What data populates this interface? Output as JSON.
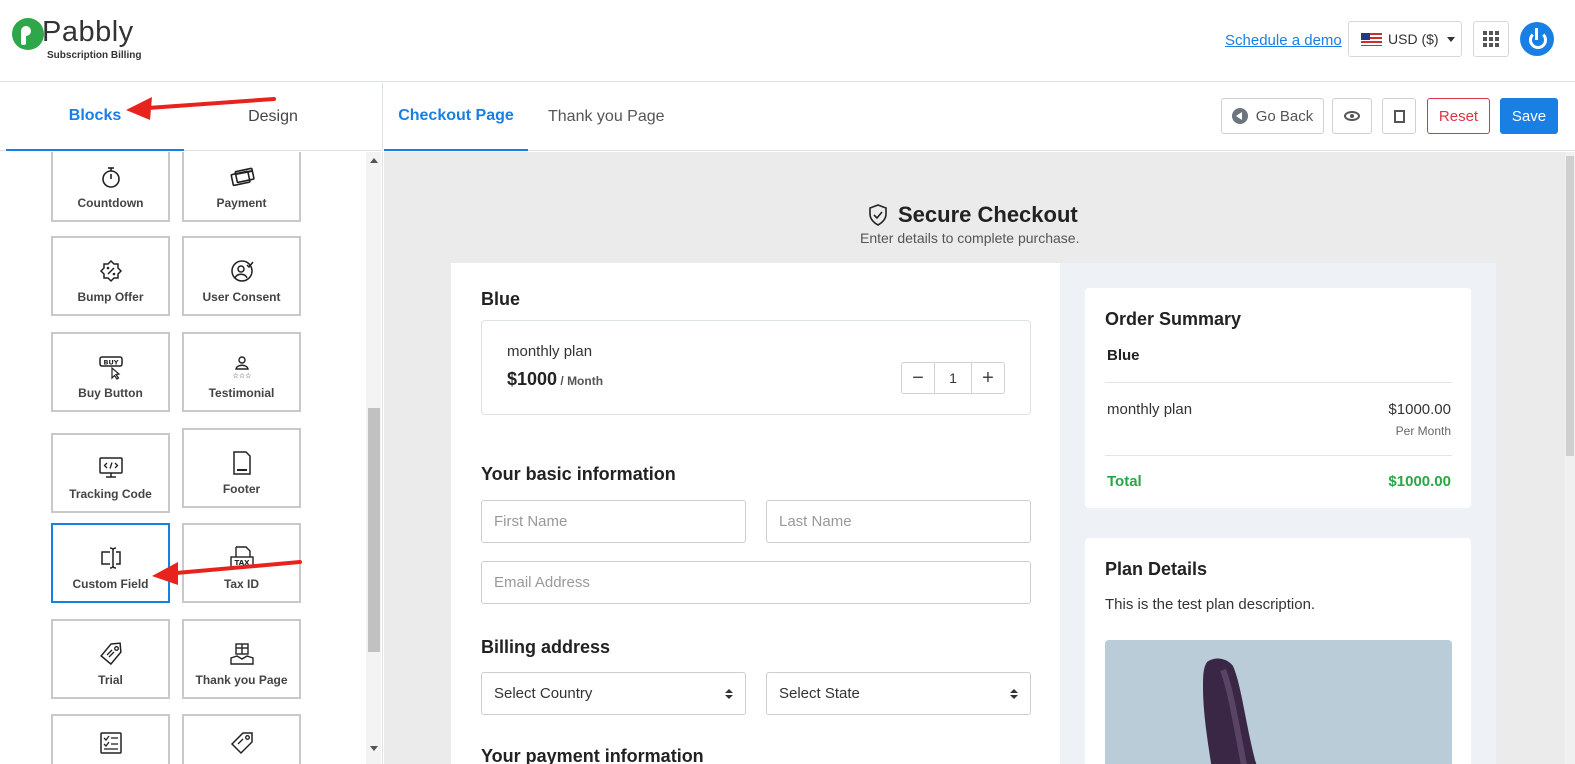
{
  "brand": {
    "name": "Pabbly",
    "subtitle": "Subscription Billing"
  },
  "header": {
    "demo_link": "Schedule a demo",
    "currency": "USD ($)"
  },
  "left_panel": {
    "tabs": [
      {
        "label": "Blocks",
        "active": true
      },
      {
        "label": "Design",
        "active": false
      }
    ],
    "blocks": [
      {
        "label": "Countdown",
        "icon": "stopwatch-icon"
      },
      {
        "label": "Payment",
        "icon": "credit-cards-icon"
      },
      {
        "label": "Bump Offer",
        "icon": "discount-badge-icon"
      },
      {
        "label": "User Consent",
        "icon": "user-check-icon"
      },
      {
        "label": "Buy Button",
        "icon": "buy-cursor-icon"
      },
      {
        "label": "Testimonial",
        "icon": "user-stars-icon"
      },
      {
        "label": "Tracking Code",
        "icon": "code-monitor-icon"
      },
      {
        "label": "Footer",
        "icon": "document-footer-icon"
      },
      {
        "label": "Custom Field",
        "icon": "text-cursor-field-icon",
        "selected": true
      },
      {
        "label": "Tax ID",
        "icon": "tax-document-icon"
      },
      {
        "label": "Trial",
        "icon": "tag-icon"
      },
      {
        "label": "Thank you Page",
        "icon": "gift-hands-icon"
      },
      {
        "label": "",
        "icon": "checklist-icon"
      },
      {
        "label": "",
        "icon": "price-tag-icon"
      }
    ]
  },
  "page_tabs": [
    {
      "label": "Checkout Page",
      "active": true
    },
    {
      "label": "Thank you Page",
      "active": false
    }
  ],
  "toolbar": {
    "go_back": "Go Back",
    "reset": "Reset",
    "save": "Save"
  },
  "checkout": {
    "title": "Secure Checkout",
    "subtitle": "Enter details to complete purchase.",
    "product_name": "Blue",
    "plan": {
      "name": "monthly plan",
      "price": "$1000",
      "period": " / Month",
      "quantity": "1"
    },
    "basic_info_heading": "Your basic information",
    "first_name_placeholder": "First Name",
    "last_name_placeholder": "Last Name",
    "email_placeholder": "Email Address",
    "billing_heading": "Billing address",
    "country_select": "Select Country",
    "state_select": "Select State",
    "payment_heading": "Your payment information"
  },
  "order_summary": {
    "title": "Order Summary",
    "product": "Blue",
    "item_name": "monthly plan",
    "item_amount": "$1000.00",
    "item_period": "Per Month",
    "total_label": "Total",
    "total_amount": "$1000.00"
  },
  "plan_details": {
    "title": "Plan Details",
    "description": "This is the test plan description."
  },
  "colors": {
    "accent": "#1a7fe2",
    "success": "#28a745",
    "danger": "#dc3545",
    "annotation": "#e8231d"
  }
}
